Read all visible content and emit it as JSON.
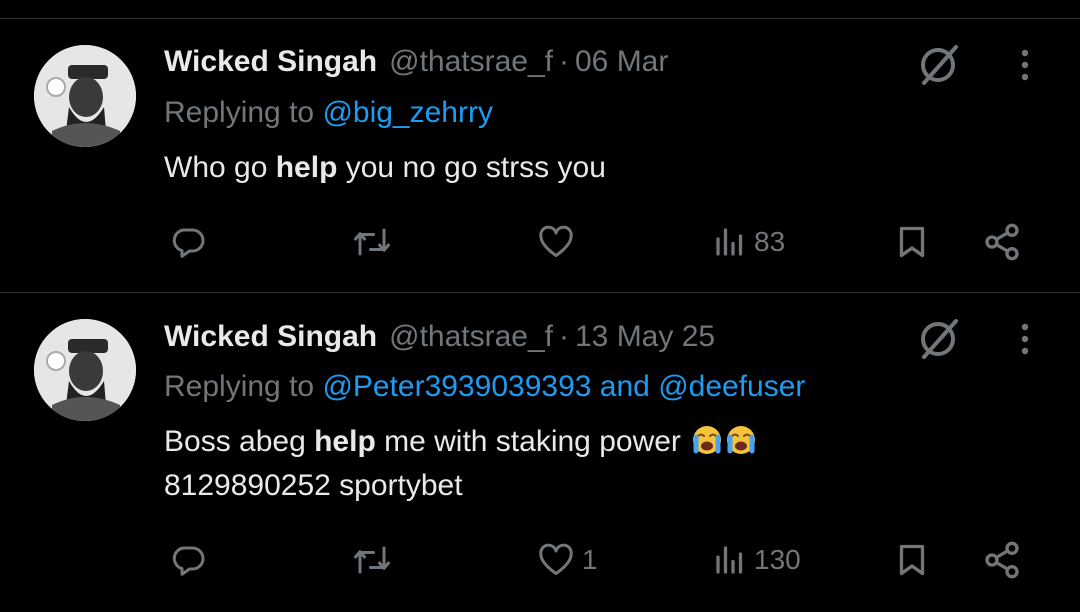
{
  "tweets": [
    {
      "author_name": "Wicked Singah",
      "handle": "@thatsrae_f",
      "separator": "·",
      "date": "06 Mar",
      "replying_prefix": "Replying to",
      "replying_to": [
        "@big_zehrry"
      ],
      "replying_joiner": "",
      "text_before": "Who go ",
      "text_bold": "help",
      "text_after": " you no go strss you",
      "text_line2": "",
      "emoji": [
        "",
        ""
      ],
      "actions": {
        "reply_count": "",
        "retweet_count": "",
        "like_count": "",
        "views_count": "83"
      }
    },
    {
      "author_name": "Wicked Singah",
      "handle": "@thatsrae_f",
      "separator": "·",
      "date": "13 May 25",
      "replying_prefix": "Replying to",
      "replying_to": [
        "@Peter3939039393",
        "@deefuser"
      ],
      "replying_joiner": "and",
      "text_before": "Boss abeg ",
      "text_bold": "help",
      "text_after": " me with staking power ",
      "text_line2": "8129890252 sportybet",
      "emoji": [
        "loudly-crying-face",
        "loudly-crying-face"
      ],
      "actions": {
        "reply_count": "",
        "retweet_count": "",
        "like_count": "1",
        "views_count": "130"
      }
    }
  ],
  "colors": {
    "background": "#000000",
    "text": "#e7e9ea",
    "muted": "#71767b",
    "link": "#1d9bf0",
    "divider": "#2f3336"
  },
  "icons": [
    "reply-icon",
    "retweet-icon",
    "like-icon",
    "views-icon",
    "bookmark-icon",
    "share-icon",
    "grok-icon",
    "more-icon"
  ]
}
